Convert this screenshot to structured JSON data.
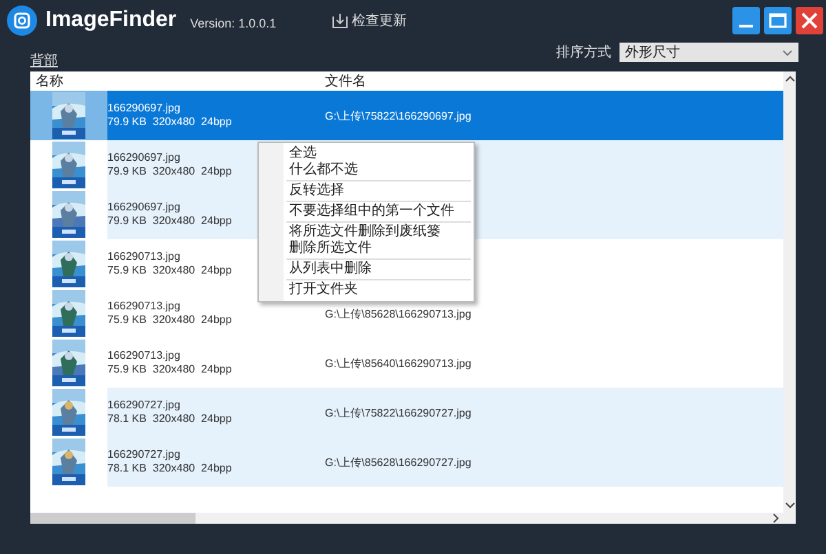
{
  "window": {
    "title": "ImageFinder",
    "version": "Version: 1.0.0.1",
    "update_button": "检查更新"
  },
  "group_link": "背部",
  "sort": {
    "label": "排序方式",
    "value": "外形尺寸"
  },
  "table": {
    "columns": [
      "名称",
      "文件名"
    ],
    "rows": [
      {
        "name": "166290697.jpg",
        "meta": "79.9 KB  320x480  24bpp",
        "path": "G:\\上传\\75822\\166290697.jpg",
        "selected": true,
        "highlighted": true
      },
      {
        "name": "166290697.jpg",
        "meta": "79.9 KB  320x480  24bpp",
        "selected": false,
        "highlighted": true
      },
      {
        "name": "166290697.jpg",
        "meta": "79.9 KB  320x480  24bpp",
        "selected": false,
        "highlighted": true
      },
      {
        "name": "166290713.jpg",
        "meta": "75.9 KB  320x480  24bpp",
        "selected": false,
        "highlighted": false
      },
      {
        "name": "166290713.jpg",
        "meta": "75.9 KB  320x480  24bpp",
        "path": "G:\\上传\\85628\\166290713.jpg",
        "selected": false,
        "highlighted": false
      },
      {
        "name": "166290713.jpg",
        "meta": "75.9 KB  320x480  24bpp",
        "path": "G:\\上传\\85640\\166290713.jpg",
        "selected": false,
        "highlighted": false
      },
      {
        "name": "166290727.jpg",
        "meta": "78.1 KB  320x480  24bpp",
        "path": "G:\\上传\\75822\\166290727.jpg",
        "selected": false,
        "highlighted": true
      },
      {
        "name": "166290727.jpg",
        "meta": "78.1 KB  320x480  24bpp",
        "path": "G:\\上传\\85628\\166290727.jpg",
        "selected": false,
        "highlighted": true
      }
    ]
  },
  "context_menu": [
    {
      "kind": "item",
      "label": "全选"
    },
    {
      "kind": "item",
      "label": "什么都不选"
    },
    {
      "kind": "separator"
    },
    {
      "kind": "item",
      "label": "反转选择"
    },
    {
      "kind": "separator"
    },
    {
      "kind": "item",
      "label": "不要选择组中的第一个文件"
    },
    {
      "kind": "separator"
    },
    {
      "kind": "item",
      "label": "将所选文件删除到废纸篓"
    },
    {
      "kind": "item",
      "label": "删除所选文件"
    },
    {
      "kind": "separator"
    },
    {
      "kind": "item",
      "label": "从列表中删除"
    },
    {
      "kind": "separator"
    },
    {
      "kind": "item",
      "label": "打开文件夹"
    }
  ]
}
